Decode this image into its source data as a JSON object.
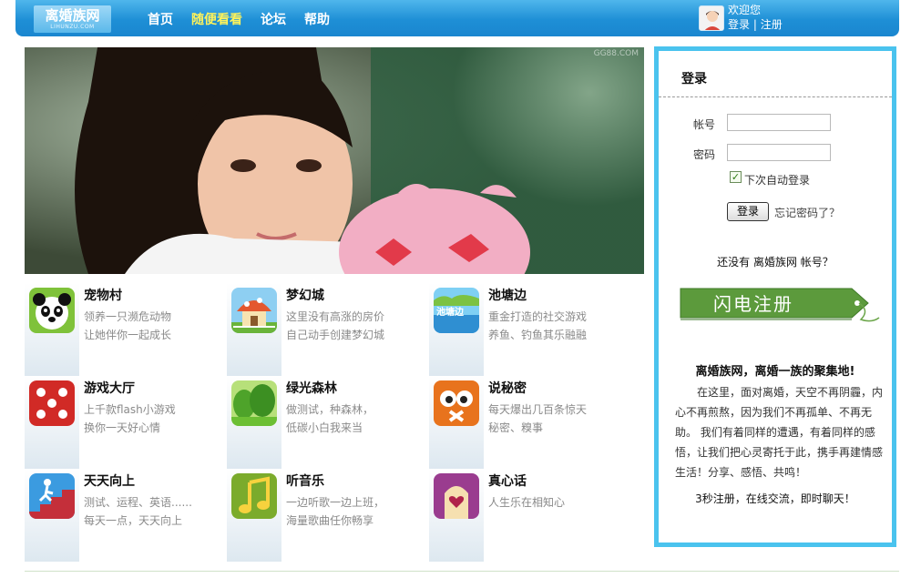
{
  "header": {
    "logo_text": "离婚族网",
    "logo_sub": "LIHUNZU.COM",
    "nav": [
      {
        "label": "首页",
        "active": false
      },
      {
        "label": "随便看看",
        "active": true
      },
      {
        "label": "论坛",
        "active": false
      },
      {
        "label": "帮助",
        "active": false
      }
    ],
    "welcome": "欢迎您",
    "login_link": "登录",
    "divider": "|",
    "register_link": "注册",
    "nav_active_color": "#fff35a"
  },
  "banner": {
    "watermark": "GG88.COM"
  },
  "features": [
    {
      "title": "宠物村",
      "line1": "领养一只濒危动物",
      "line2": "让她伴你一起成长",
      "icon": "panda-icon"
    },
    {
      "title": "梦幻城",
      "line1": "这里没有高涨的房价",
      "line2": "自己动手创建梦幻城",
      "icon": "mushroom-house-icon"
    },
    {
      "title": "池塘边",
      "line1": "重金打造的社交游戏",
      "line2": "养鱼、钓鱼其乐融融",
      "icon": "pond-icon",
      "icon_text": "池塘边"
    },
    {
      "title": "游戏大厅",
      "line1": "上千款flash小游戏",
      "line2": "换你一天好心情",
      "icon": "dice-icon"
    },
    {
      "title": "绿光森林",
      "line1": "做测试，种森林，",
      "line2": "低碳小白我来当",
      "icon": "forest-icon"
    },
    {
      "title": "说秘密",
      "line1": "每天爆出几百条惊天",
      "line2": "秘密、糗事",
      "icon": "owl-icon"
    },
    {
      "title": "天天向上",
      "line1": "测试、运程、英语......",
      "line2": "每天一点，天天向上",
      "icon": "stairs-icon"
    },
    {
      "title": "听音乐",
      "line1": "一边听歌一边上班，",
      "line2": "海量歌曲任你畅享",
      "icon": "music-note-icon"
    },
    {
      "title": "真心话",
      "line1": "人生乐在相知心",
      "line2": "",
      "icon": "heart-icon"
    }
  ],
  "login": {
    "title": "登录",
    "account_label": "帐号",
    "account_value": "",
    "password_label": "密码",
    "password_value": "",
    "remember_label": "下次自动登录",
    "remember_checked": true,
    "submit_label": "登录",
    "forgot_label": "忘记密码了？",
    "no_account_text": "还没有 离婚族网 帐号？",
    "flash_register_label": "闪电注册",
    "slogan": "离婚族网，离婚一族的聚集地!",
    "paragraph": "在这里，面对离婚，天空不再阴霾，内心不再煎熬，因为我们不再孤单、不再无助。 我们有着同样的遭遇，有着同样的感悟，让我们把心灵寄托于此，携手再建情感生活！分享、感悟、共鸣！",
    "footer_text": "3秒注册，在线交流，即时聊天！",
    "panel_border_color": "#4ac3ee"
  }
}
